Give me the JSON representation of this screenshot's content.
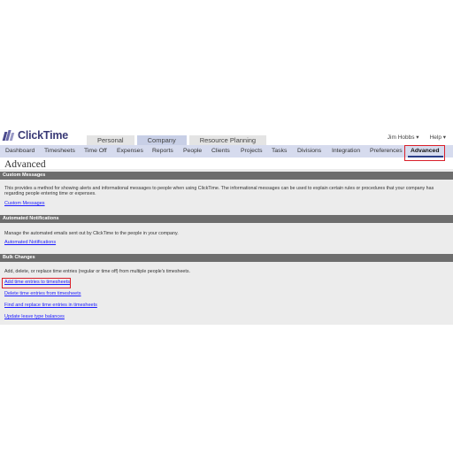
{
  "app": {
    "logo_text": "ClickTime"
  },
  "top_tabs": [
    {
      "label": "Personal",
      "active": false
    },
    {
      "label": "Company",
      "active": true
    },
    {
      "label": "Resource Planning",
      "active": false
    }
  ],
  "user_menu": {
    "user": "Jim Hobbs ▾",
    "help": "Help ▾"
  },
  "nav": {
    "items": [
      "Dashboard",
      "Timesheets",
      "Time Off",
      "Expenses",
      "Reports",
      "People",
      "Clients",
      "Projects",
      "Tasks",
      "Divisions",
      "Integration",
      "Preferences",
      "Advanced"
    ],
    "active": "Advanced"
  },
  "page_title": "Advanced",
  "sections": [
    {
      "header": "Custom Messages",
      "description": "This provides a method for showing alerts and informational messages to people when using ClickTime. The informational messages can be used to explain certain rules or procedures that your company has regarding people entering time or expenses.",
      "links": [
        "Custom Messages"
      ]
    },
    {
      "header": "Automated Notifications",
      "description": "Manage the automated emails sent out by ClickTime to the people in your company.",
      "links": [
        "Automated Notifications"
      ]
    },
    {
      "header": "Bulk Changes",
      "description": "Add, delete, or replace time entries (regular or time off) from multiple people's timesheets.",
      "links": [
        "Add time entries to timesheets",
        "Delete time entries from timesheets",
        "Find and replace time entries in timesheets",
        "Update leave type balances"
      ]
    }
  ],
  "colors": {
    "highlight": "#d9202a",
    "nav_bg": "#d6dbee",
    "section_header_bg": "#6d6d6d",
    "link": "#1a1aff"
  }
}
